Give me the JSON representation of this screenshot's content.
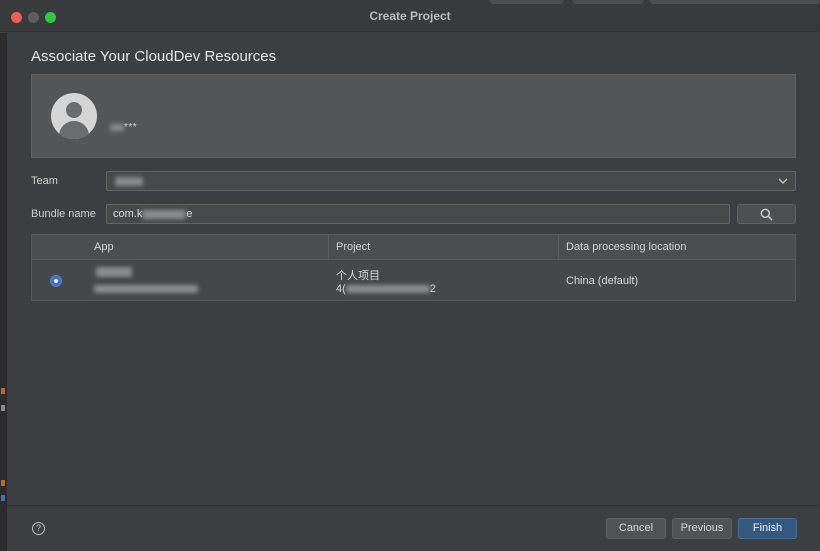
{
  "window": {
    "title": "Create Project"
  },
  "dialog": {
    "heading": "Associate Your CloudDev Resources",
    "account": {
      "name_suffix": "***"
    },
    "team": {
      "label": "Team"
    },
    "bundle": {
      "label": "Bundle name",
      "prefix": "com.k",
      "suffix": "e"
    },
    "table": {
      "headers": {
        "app": "App",
        "project": "Project",
        "location": "Data processing location"
      },
      "rows": [
        {
          "project_name": "个人项目",
          "project_id_prefix": "4(",
          "project_id_suffix": "2",
          "location": "China (default)"
        }
      ]
    },
    "buttons": {
      "cancel": "Cancel",
      "previous": "Previous",
      "finish": "Finish",
      "help": "?"
    }
  },
  "colors": {
    "accent": "#365880",
    "radio": "#3f6fc8",
    "close": "#ec5f57",
    "zoom": "#2fc83f"
  },
  "icons": [
    "user-avatar-icon",
    "chevron-down-icon",
    "search-icon",
    "help-icon"
  ]
}
